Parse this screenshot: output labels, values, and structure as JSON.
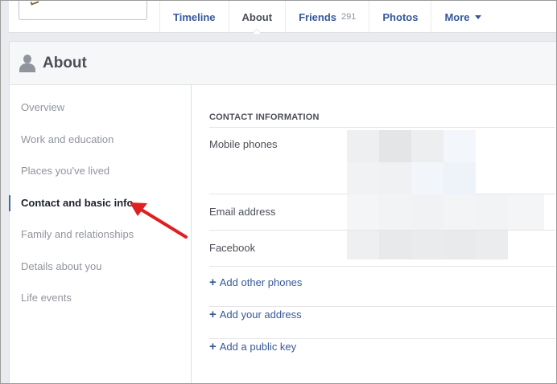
{
  "tabs": [
    {
      "label": "Timeline"
    },
    {
      "label": "About"
    },
    {
      "label": "Friends",
      "count": "291"
    },
    {
      "label": "Photos"
    },
    {
      "label": "More"
    }
  ],
  "header": {
    "title": "About",
    "icon": "person-icon"
  },
  "sidebar": {
    "items": [
      {
        "label": "Overview"
      },
      {
        "label": "Work and education"
      },
      {
        "label": "Places you've lived"
      },
      {
        "label": "Contact and basic info"
      },
      {
        "label": "Family and relationships"
      },
      {
        "label": "Details about you"
      },
      {
        "label": "Life events"
      }
    ],
    "active_index": 3
  },
  "contact": {
    "section_title": "CONTACT INFORMATION",
    "rows": [
      {
        "label": "Mobile phones"
      },
      {
        "label": "Email address"
      },
      {
        "label": "Facebook"
      }
    ],
    "add_links": [
      {
        "label": "Add other phones"
      },
      {
        "label": "Add your address"
      },
      {
        "label": "Add a public key"
      }
    ]
  },
  "colors": {
    "link": "#365899",
    "accent": "#4267b2",
    "annotation": "#e02020"
  }
}
